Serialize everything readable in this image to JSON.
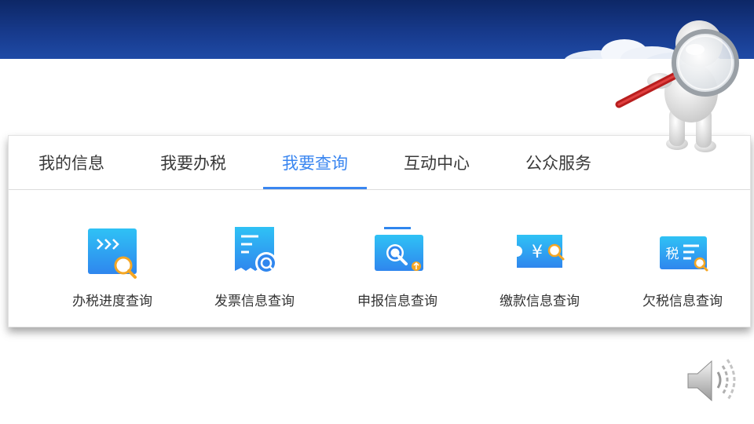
{
  "tabs": [
    {
      "label": "我的信息"
    },
    {
      "label": "我要办税"
    },
    {
      "label": "我要查询",
      "active": true
    },
    {
      "label": "互动中心"
    },
    {
      "label": "公众服务"
    }
  ],
  "services": [
    {
      "label": "办税进度查询",
      "icon": "progress-query-icon"
    },
    {
      "label": "发票信息查询",
      "icon": "invoice-query-icon"
    },
    {
      "label": "申报信息查询",
      "icon": "declaration-query-icon"
    },
    {
      "label": "缴款信息查询",
      "icon": "payment-query-icon"
    },
    {
      "label": "欠税信息查询",
      "icon": "arrears-query-icon"
    }
  ],
  "icon_glyphs": {
    "payment": "¥",
    "tax": "税"
  },
  "colors": {
    "banner": "#0d2766",
    "accent": "#3a86f0",
    "icon_blue": "#2ea8f0",
    "magnifier": "#f5a623"
  }
}
